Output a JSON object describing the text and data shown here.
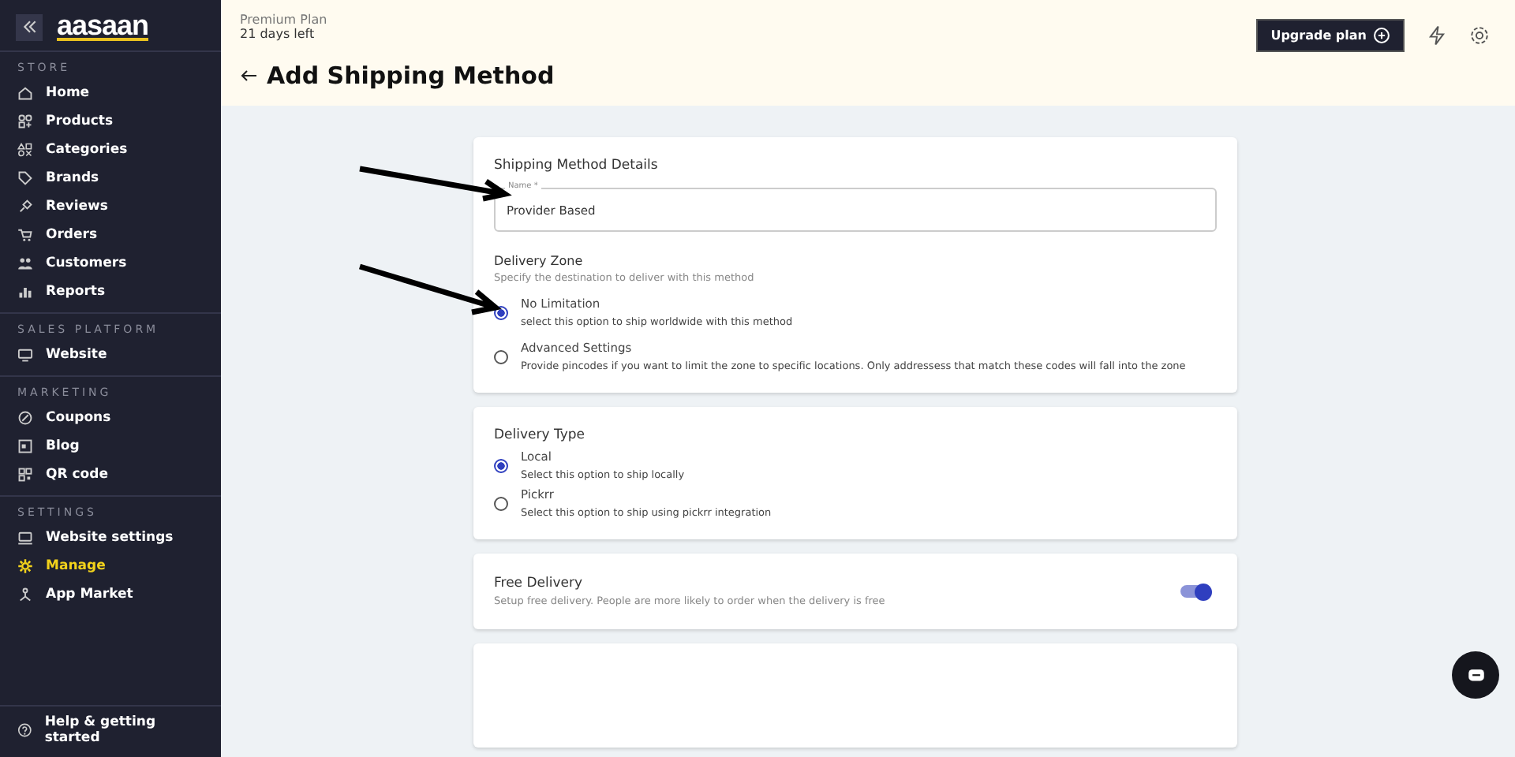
{
  "sidebar": {
    "logo": "aasaan",
    "sections": [
      {
        "label": "STORE",
        "items": [
          {
            "label": "Home",
            "selected": false
          },
          {
            "label": "Products",
            "selected": false
          },
          {
            "label": "Categories",
            "selected": false
          },
          {
            "label": "Brands",
            "selected": false
          },
          {
            "label": "Reviews",
            "selected": false
          },
          {
            "label": "Orders",
            "selected": false
          },
          {
            "label": "Customers",
            "selected": false
          },
          {
            "label": "Reports",
            "selected": false
          }
        ]
      },
      {
        "label": "SALES PLATFORM",
        "items": [
          {
            "label": "Website",
            "selected": false
          }
        ]
      },
      {
        "label": "MARKETING",
        "items": [
          {
            "label": "Coupons",
            "selected": false
          },
          {
            "label": "Blog",
            "selected": false
          },
          {
            "label": "QR code",
            "selected": false
          }
        ]
      },
      {
        "label": "SETTINGS",
        "items": [
          {
            "label": "Website settings",
            "selected": false
          },
          {
            "label": "Manage",
            "selected": true
          },
          {
            "label": "App Market",
            "selected": false
          }
        ]
      }
    ],
    "help": "Help & getting started"
  },
  "header": {
    "plan": "Premium Plan",
    "days_left": "21 days left",
    "upgrade_button": "Upgrade plan",
    "title": "Add Shipping Method"
  },
  "details": {
    "heading": "Shipping Method Details",
    "name_field": {
      "label": "Name *",
      "value": "Provider Based"
    },
    "zone_heading": "Delivery Zone",
    "zone_hint": "Specify the destination to deliver with this method",
    "zone_options": [
      {
        "label": "No Limitation",
        "description": "select this option to ship worldwide with this method",
        "selected": true
      },
      {
        "label": "Advanced Settings",
        "description": "Provide pincodes if you want to limit the zone to specific locations. Only addressess that match these codes will fall into the zone",
        "selected": false
      }
    ]
  },
  "delivery_type": {
    "heading": "Delivery Type",
    "options": [
      {
        "label": "Local",
        "description": "Select this option to ship locally",
        "selected": true
      },
      {
        "label": "Pickrr",
        "description": "Select this option to ship using pickrr integration",
        "selected": false
      }
    ]
  },
  "free_delivery": {
    "heading": "Free Delivery",
    "description": "Setup free delivery. People are more likely to order when the delivery is free",
    "on": true
  }
}
